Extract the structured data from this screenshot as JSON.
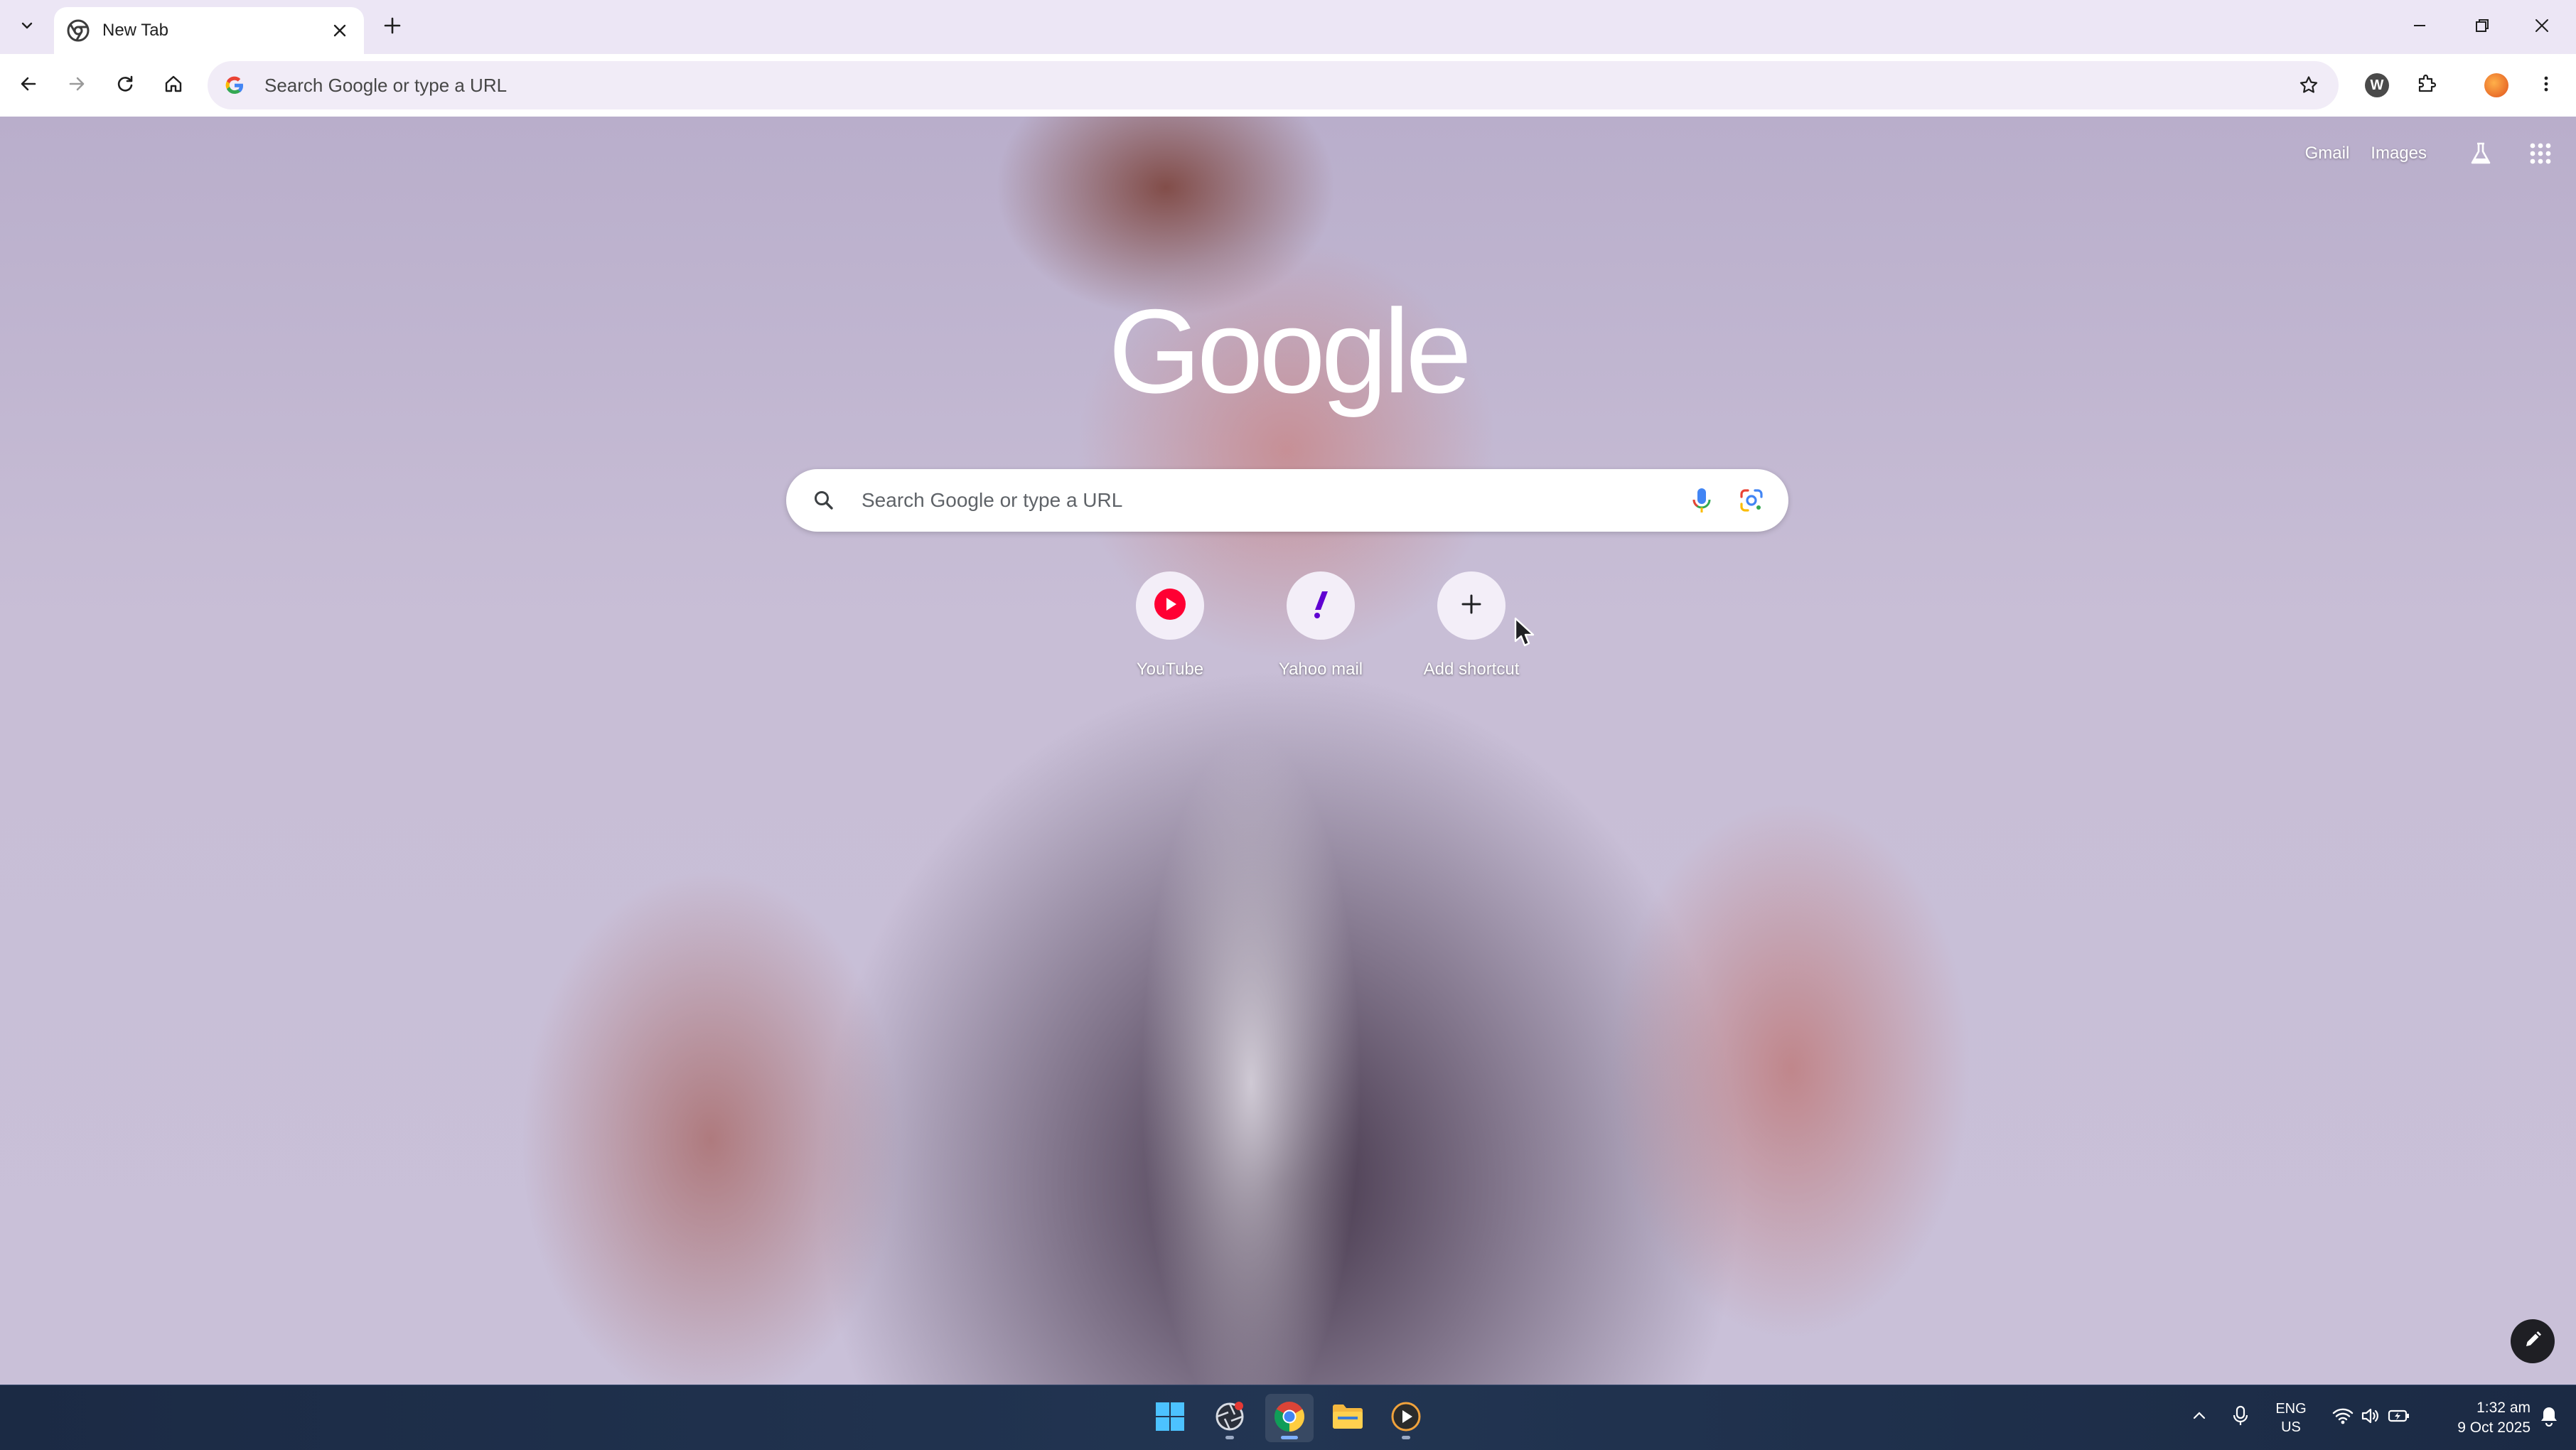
{
  "browser": {
    "tab": {
      "title": "New Tab"
    },
    "omnibox": {
      "placeholder": "Search Google or type a URL"
    },
    "extension_badge": "W"
  },
  "ntp": {
    "top_links": {
      "gmail": "Gmail",
      "images": "Images"
    },
    "logo": "Google",
    "search": {
      "placeholder": "Search Google or type a URL"
    },
    "shortcuts": [
      {
        "label": "YouTube",
        "icon": "youtube-icon"
      },
      {
        "label": "Yahoo mail",
        "icon": "yahoo-mail-icon"
      },
      {
        "label": "Add shortcut",
        "icon": "plus-icon"
      }
    ]
  },
  "taskbar": {
    "lang": {
      "line1": "ENG",
      "line2": "US"
    },
    "clock": {
      "time": "1:32 am",
      "date": "9 Oct 2025"
    }
  },
  "colors": {
    "accent": "#7fb0ff",
    "youtube_red": "#ff0033",
    "yahoo_purple": "#6001d2",
    "tabstrip": "#ece6f5"
  }
}
